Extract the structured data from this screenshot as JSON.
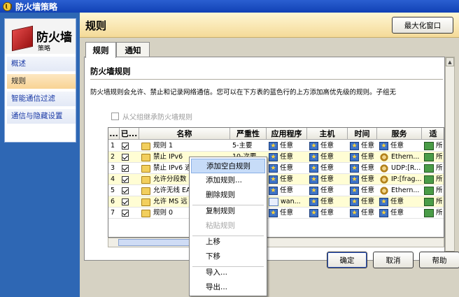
{
  "window": {
    "title": "防火墙策略"
  },
  "sidebar": {
    "title": "防火墙",
    "subtitle": "策略",
    "items": [
      {
        "label": "概述"
      },
      {
        "label": "规则"
      },
      {
        "label": "智能通信过滤"
      },
      {
        "label": "通信与隐藏设置"
      }
    ]
  },
  "header": {
    "title": "规则",
    "maximize_label": "最大化窗口"
  },
  "tabs": [
    {
      "label": "规则"
    },
    {
      "label": "通知"
    }
  ],
  "section": {
    "title": "防火墙规则",
    "description": "防火墙规则会允许、禁止和记录网络通信。您可以在下方表的蓝色行的上方添加高优先级的规则。子组无",
    "inherit_label": "从父组继承防火墙规则"
  },
  "table": {
    "columns": [
      "...",
      "已...",
      "名称",
      "严重性",
      "应用程序",
      "主机",
      "时间",
      "服务",
      "适"
    ],
    "rows": [
      {
        "num": "1",
        "name": "规则 1",
        "severity": "5-主要",
        "app": "任意",
        "host": "任意",
        "time": "任意",
        "service": "任意",
        "target": "所"
      },
      {
        "num": "2",
        "name": "禁止 IPv6",
        "severity": "10-次要",
        "app": "任意",
        "host": "任意",
        "time": "任意",
        "service": "Ethern...",
        "target": "所"
      },
      {
        "num": "3",
        "name": "禁止 IPv6 通",
        "severity": "",
        "app": "任意",
        "host": "任意",
        "time": "任意",
        "service": "UDP:[R...",
        "target": "所"
      },
      {
        "num": "4",
        "name": "允许分段数",
        "severity": "",
        "app": "任意",
        "host": "任意",
        "time": "任意",
        "service": "IP:[frag...",
        "target": "所"
      },
      {
        "num": "5",
        "name": "允许无线 EA",
        "severity": "",
        "app": "任意",
        "host": "任意",
        "time": "任意",
        "service": "Ethern...",
        "target": "所"
      },
      {
        "num": "6",
        "name": "允许 MS 远",
        "severity": "",
        "app": "wan...",
        "host": "任意",
        "time": "任意",
        "service": "任意",
        "target": "所"
      },
      {
        "num": "7",
        "name": "规则 0",
        "severity": "",
        "app": "任意",
        "host": "任意",
        "time": "任意",
        "service": "任意",
        "target": "所"
      }
    ]
  },
  "context_menu": {
    "items": [
      {
        "label": "添加空白规则"
      },
      {
        "label": "添加规则..."
      },
      {
        "label": "删除规则"
      },
      {
        "label": "复制规则"
      },
      {
        "label": "粘贴规则"
      },
      {
        "label": "上移"
      },
      {
        "label": "下移"
      },
      {
        "label": "导入..."
      },
      {
        "label": "导出..."
      }
    ]
  },
  "buttons": {
    "ok": "确定",
    "cancel": "取消",
    "help": "帮助"
  }
}
